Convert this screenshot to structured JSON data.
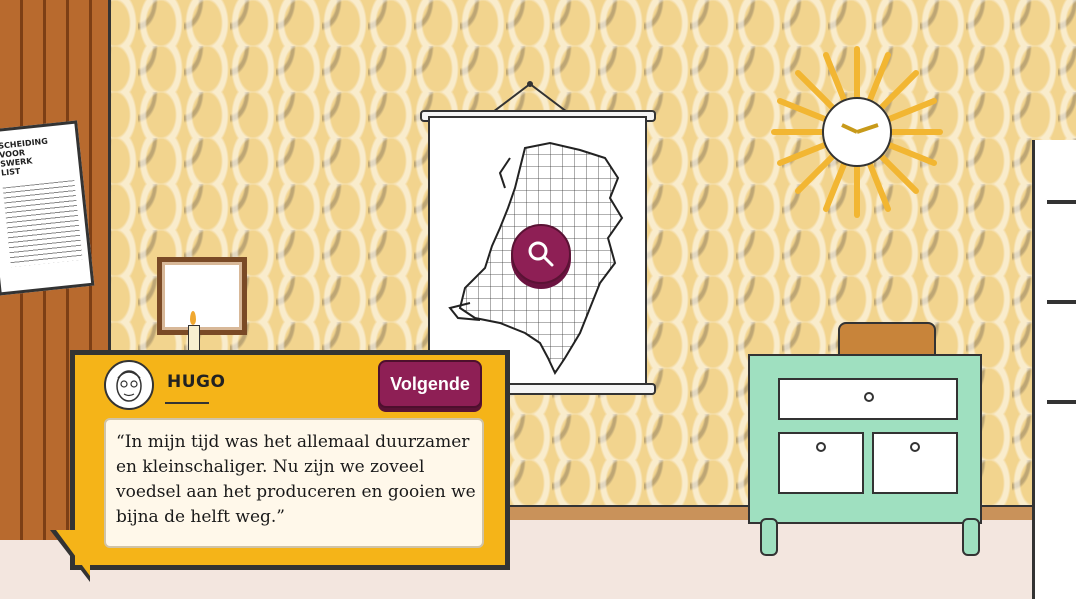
{
  "dialog": {
    "speaker": "HUGO",
    "next_label": "Volgende",
    "text": "“In mijn tijd was het allemaal duurzamer en kleinschaliger. Nu zijn we zoveel voedsel aan het produceren en gooien we bijna de helft weg.”"
  },
  "poster": {
    "title_line1": "SCHEIDING VOOR",
    "title_line2": "SWERK",
    "title_line3": "LIST"
  },
  "map": {
    "icon": "magnifier-icon"
  },
  "colors": {
    "dialog_bg": "#f5b418",
    "accent": "#8e1f55",
    "wallpaper": "#f2d48e",
    "dresser": "#9fe0c0"
  }
}
